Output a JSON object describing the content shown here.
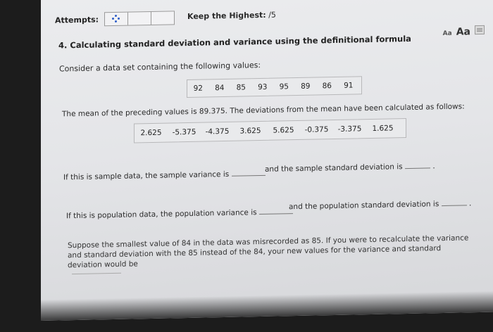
{
  "header": {
    "attempts_label": "Attempts:",
    "keep_highest_label": "Keep the Highest:",
    "keep_highest_value": "/5",
    "font_small": "Aa",
    "font_large": "Aa"
  },
  "question": {
    "title": "4. Calculating standard deviation and variance using the definitional formula",
    "intro": "Consider a data set containing the following values:",
    "data_values": [
      "92",
      "84",
      "85",
      "93",
      "95",
      "89",
      "86",
      "91"
    ],
    "mean_text": "The mean of the preceding values is 89.375. The deviations from the mean have been calculated as follows:",
    "deviations": [
      "2.625",
      "-5.375",
      "-4.375",
      "3.625",
      "5.625",
      "-0.375",
      "-3.375",
      "1.625"
    ],
    "sample_variance_text": "If this is sample data, the sample variance is",
    "sample_sd_text": "and the sample standard deviation is",
    "population_variance_text": "If this is population data, the population variance is",
    "population_sd_text": "and the population standard deviation is",
    "period": ".",
    "recalc_paragraph": "Suppose the smallest value of 84 in the data was misrecorded as 85. If you were to recalculate the variance and standard deviation with the 85 instead of the 84, your new values for the variance and standard deviation would be"
  },
  "colors": {
    "spinner": "#2e5ec9",
    "box_border": "#b8b8ba"
  }
}
